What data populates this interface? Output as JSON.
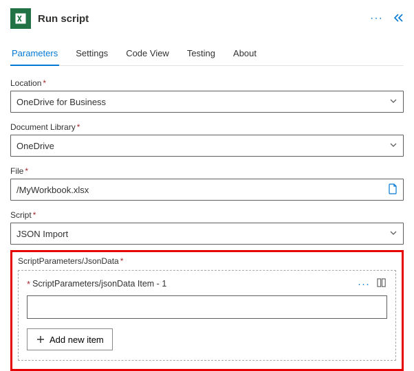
{
  "header": {
    "title": "Run script"
  },
  "tabs": [
    {
      "label": "Parameters",
      "active": true
    },
    {
      "label": "Settings",
      "active": false
    },
    {
      "label": "Code View",
      "active": false
    },
    {
      "label": "Testing",
      "active": false
    },
    {
      "label": "About",
      "active": false
    }
  ],
  "fields": {
    "location": {
      "label": "Location",
      "value": "OneDrive for Business"
    },
    "document_library": {
      "label": "Document Library",
      "value": "OneDrive"
    },
    "file": {
      "label": "File",
      "value": "/MyWorkbook.xlsx"
    },
    "script": {
      "label": "Script",
      "value": "JSON Import"
    }
  },
  "json_section": {
    "label": "ScriptParameters/JsonData",
    "item_label": "ScriptParameters/jsonData Item - 1",
    "item_value": "",
    "add_button": "Add new item"
  }
}
